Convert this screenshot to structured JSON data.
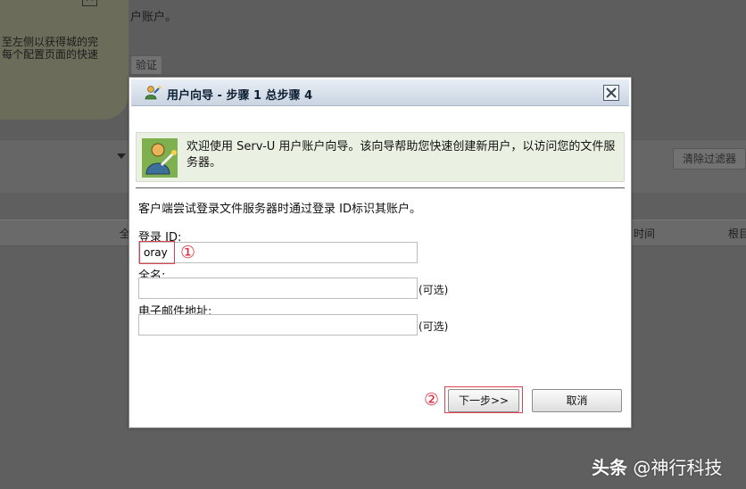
{
  "background": {
    "top_text": "户账户。",
    "tip_text_line1": "至左侧以获得城的完",
    "tip_text_line2": "每个配置页面的快速",
    "test_button": "验证",
    "clear_filter_button": "清除过滤器",
    "col_all": "全",
    "col_time": "时间",
    "col_root": "根目"
  },
  "dialog": {
    "title": "用户向导 - 步骤 1 总步骤 4",
    "banner": "欢迎使用 Serv-U 用户账户向导。该向导帮助您快速创建新用户，以访问您的文件服务器。",
    "intro": "客户端尝试登录文件服务器时通过登录 ID标识其账户。",
    "login_label": "登录 ID:",
    "login_value": "oray",
    "fullname_label": "全名:",
    "fullname_value": "",
    "email_label": "电子邮件地址:",
    "email_value": "",
    "optional": "(可选)",
    "next_button": "下一步>>",
    "cancel_button": "取消",
    "marker_1": "①",
    "marker_2": "②"
  },
  "watermark": {
    "brand": "头条",
    "handle": "@神行科技"
  },
  "colors": {
    "overlay": "#5f5f5f",
    "titlebar": "#c9d4e2",
    "banner": "#eaf1e2",
    "annotation_red": "#e04050"
  }
}
